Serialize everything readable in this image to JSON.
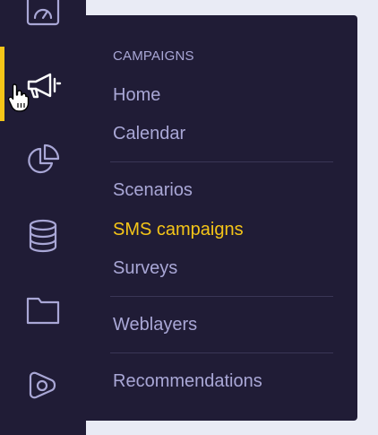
{
  "sidebar": {
    "items": [
      {
        "icon": "dashboard-gauge-icon"
      },
      {
        "icon": "megaphone-icon",
        "active": true
      },
      {
        "icon": "pie-chart-icon"
      },
      {
        "icon": "database-icon"
      },
      {
        "icon": "folder-icon"
      },
      {
        "icon": "recommendation-eye-icon"
      }
    ]
  },
  "flyout": {
    "section_title": "CAMPAIGNS",
    "items": [
      {
        "label": "Home"
      },
      {
        "label": "Calendar"
      },
      {
        "label": "Scenarios"
      },
      {
        "label": "SMS campaigns",
        "active": true
      },
      {
        "label": "Surveys"
      },
      {
        "label": "Weblayers"
      },
      {
        "label": "Recommendations"
      }
    ]
  },
  "colors": {
    "sidebar_bg": "#201c36",
    "page_bg": "#e9ebf5",
    "menu_text": "#a9a7d6",
    "active_accent": "#f5c518",
    "divider": "#3a3656"
  }
}
